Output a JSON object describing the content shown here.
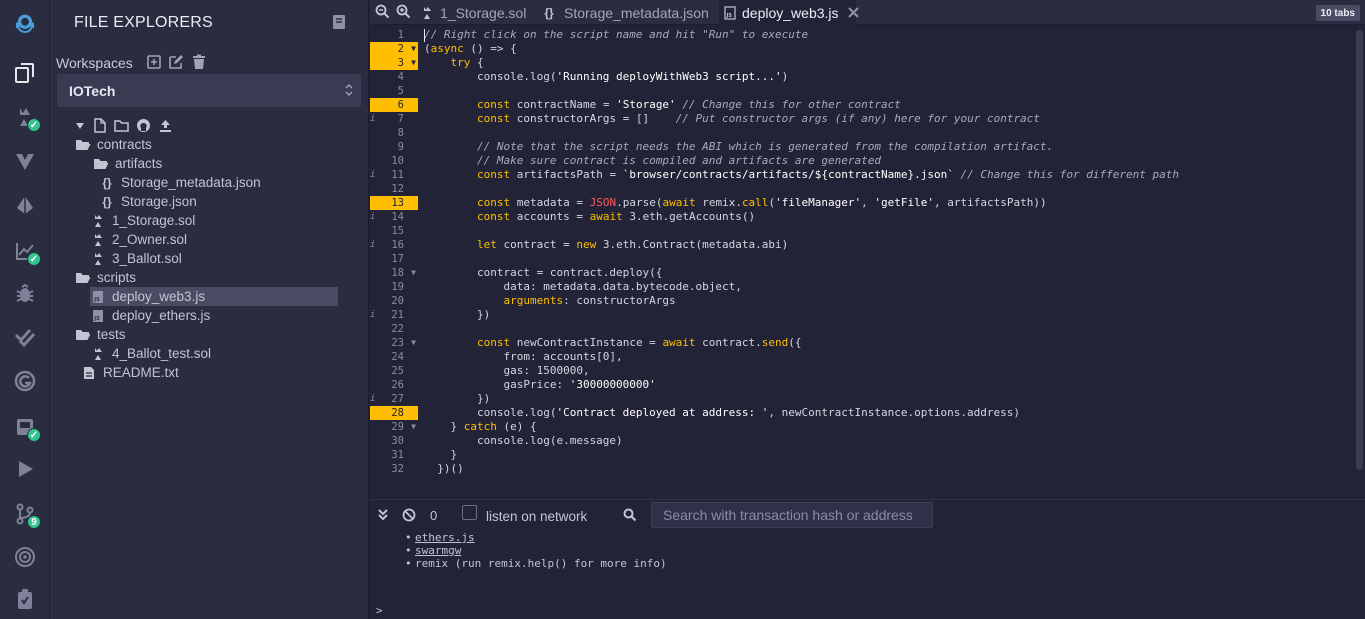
{
  "explorer": {
    "title": "FILE EXPLORERS",
    "workspaces_label": "Workspaces",
    "workspace": "IOTech",
    "tree": [
      {
        "label": "contracts",
        "type": "folder",
        "depth": 0
      },
      {
        "label": "artifacts",
        "type": "folder",
        "depth": 1
      },
      {
        "label": "Storage_metadata.json",
        "type": "json",
        "depth": 2
      },
      {
        "label": "Storage.json",
        "type": "json",
        "depth": 2
      },
      {
        "label": "1_Storage.sol",
        "type": "sol",
        "depth": 1
      },
      {
        "label": "2_Owner.sol",
        "type": "sol",
        "depth": 1
      },
      {
        "label": "3_Ballot.sol",
        "type": "sol",
        "depth": 1
      },
      {
        "label": "scripts",
        "type": "folder",
        "depth": 0
      },
      {
        "label": "deploy_web3.js",
        "type": "js",
        "depth": 1,
        "selected": true
      },
      {
        "label": "deploy_ethers.js",
        "type": "js",
        "depth": 1
      },
      {
        "label": "tests",
        "type": "folder",
        "depth": 0
      },
      {
        "label": "4_Ballot_test.sol",
        "type": "sol",
        "depth": 1
      },
      {
        "label": "README.txt",
        "type": "txt",
        "depth": 0
      }
    ]
  },
  "tabs": {
    "items": [
      {
        "label": "1_Storage.sol",
        "icon": "solidity-icon"
      },
      {
        "label": "Storage_metadata.json",
        "icon": "json-icon"
      },
      {
        "label": "deploy_web3.js",
        "icon": "js-file-icon",
        "active": true
      }
    ],
    "count": "10 tabs"
  },
  "editor": {
    "highlighted_lines": [
      2,
      3,
      6,
      13,
      28
    ],
    "info_lines": [
      7,
      11,
      14,
      16,
      21,
      27
    ],
    "fold_lines": [
      2,
      3,
      18,
      23,
      29
    ],
    "lines": [
      "// Right click on the script name and hit \"Run\" to execute",
      "(async () => {",
      "    try {",
      "        console.log('Running deployWithWeb3 script...')",
      "",
      "        const contractName = 'Storage' // Change this for other contract",
      "        const constructorArgs = []    // Put constructor args (if any) here for your contract",
      "",
      "        // Note that the script needs the ABI which is generated from the compilation artifact.",
      "        // Make sure contract is compiled and artifacts are generated",
      "        const artifactsPath = `browser/contracts/artifacts/${contractName}.json` // Change this for different path",
      "",
      "        const metadata = JSON.parse(await remix.call('fileManager', 'getFile', artifactsPath))",
      "        const accounts = await web3.eth.getAccounts()",
      "",
      "        let contract = new web3.eth.Contract(metadata.abi)",
      "",
      "        contract = contract.deploy({",
      "            data: metadata.data.bytecode.object,",
      "            arguments: constructorArgs",
      "        })",
      "",
      "        const newContractInstance = await contract.send({",
      "            from: accounts[0],",
      "            gas: 1500000,",
      "            gasPrice: '30000000000'",
      "        })",
      "        console.log('Contract deployed at address: ', newContractInstance.options.address)",
      "    } catch (e) {",
      "        console.log(e.message)",
      "    }",
      "  })()"
    ]
  },
  "terminal": {
    "count": "0",
    "listen_label": "listen on network",
    "search_placeholder": "Search with transaction hash or address",
    "output": [
      {
        "text": "ethers.js",
        "link": true
      },
      {
        "text": "swarmgw",
        "link": true
      },
      {
        "text": "remix (run remix.help() for more info)",
        "link": false
      }
    ],
    "prompt": ">"
  },
  "rail": {
    "icons": [
      "remix-logo-icon",
      "file-explorer-icon",
      "solidity-compiler-icon",
      "vyper-icon",
      "deploy-run-icon",
      "analysis-icon",
      "debugger-icon",
      "unit-test-icon",
      "flattener-icon",
      "sourcify-icon",
      "run-script-icon",
      "git-icon",
      "optimism-icon",
      "plugin-manager-icon"
    ],
    "git_badge": "9"
  },
  "colors": {
    "accent": "#ffbf00",
    "background": "#222336",
    "panel": "#2a2c3f",
    "success": "#34c38f"
  }
}
